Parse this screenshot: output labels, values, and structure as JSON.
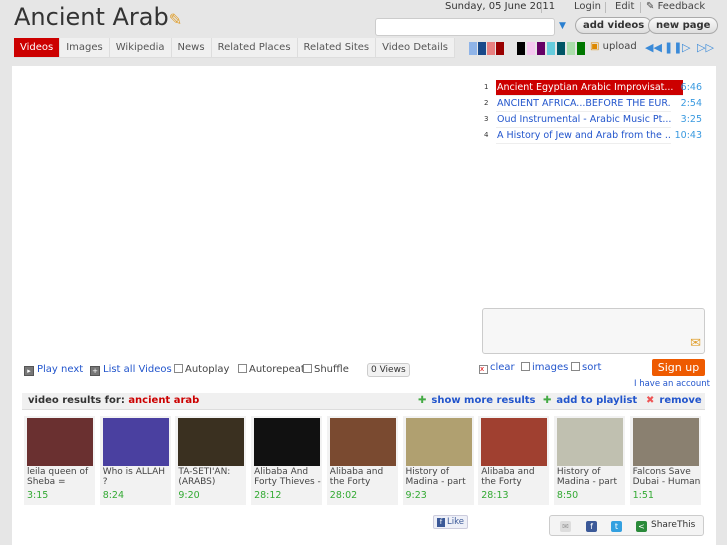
{
  "header": {
    "title": "Ancient Arab",
    "date": "Sunday, 05 June 2011",
    "login": "Login",
    "edit": "Edit",
    "feedback": "Feedback",
    "search_value": "",
    "add_videos": "add videos",
    "new_page": "new page"
  },
  "tabs": [
    "Videos",
    "Images",
    "Wikipedia",
    "News",
    "Related Places",
    "Related Sites",
    "Video Details"
  ],
  "swatches": [
    "#8fb4e8",
    "#1a4a8a",
    "#e88080",
    "#990000",
    "#000000",
    "#f5c8f0",
    "#660066",
    "#66ccdd",
    "#005566",
    "#aaddaa",
    "#007700"
  ],
  "toolbar": {
    "upload": "upload"
  },
  "playlist": [
    {
      "n": "1",
      "title": "Ancient Egyptian Arabic Improvisat...",
      "dur": "6:46"
    },
    {
      "n": "2",
      "title": "ANCIENT AFRICA...BEFORE THE EUR...",
      "dur": "2:54"
    },
    {
      "n": "3",
      "title": "Oud Instrumental - Arabic Music Pt...",
      "dur": "3:25"
    },
    {
      "n": "4",
      "title": "A History of Jew and Arab from the ...",
      "dur": "10:43"
    }
  ],
  "controls": {
    "play_next": "Play next",
    "list_all": "List all Videos",
    "autoplay": "Autoplay",
    "autorepeat": "Autorepeat",
    "shuffle": "Shuffle",
    "views": "0 Views",
    "clear": "clear",
    "images": "images",
    "sort": "sort",
    "signup": "Sign up",
    "account": "I have an account"
  },
  "results": {
    "label": "video results for:",
    "query": "ancient arab",
    "show_more": "show more results",
    "add_playlist": "add to playlist",
    "remove": "remove",
    "items": [
      {
        "title": "leila queen of Sheba =",
        "dur": "3:15",
        "c": "#6a3030"
      },
      {
        "title": "Who is ALLAH ?",
        "dur": "8:24",
        "c": "#4a40a0"
      },
      {
        "title": "TA-SETI'AN: (ARABS)",
        "dur": "9:20",
        "c": "#3a3020"
      },
      {
        "title": "Alibaba And Forty Thieves -",
        "dur": "28:12",
        "c": "#111111"
      },
      {
        "title": "Alibaba and the Forty",
        "dur": "28:02",
        "c": "#7a4a30"
      },
      {
        "title": "History of Madina - part",
        "dur": "9:23",
        "c": "#b0a070"
      },
      {
        "title": "Alibaba and the Forty",
        "dur": "28:13",
        "c": "#a04030"
      },
      {
        "title": "History of Madina - part",
        "dur": "8:50",
        "c": "#c0c0b0"
      },
      {
        "title": "Falcons Save Dubai - Human",
        "dur": "1:51",
        "c": "#8a8070"
      }
    ]
  },
  "social": {
    "like": "Like",
    "sharethis": "ShareThis"
  }
}
